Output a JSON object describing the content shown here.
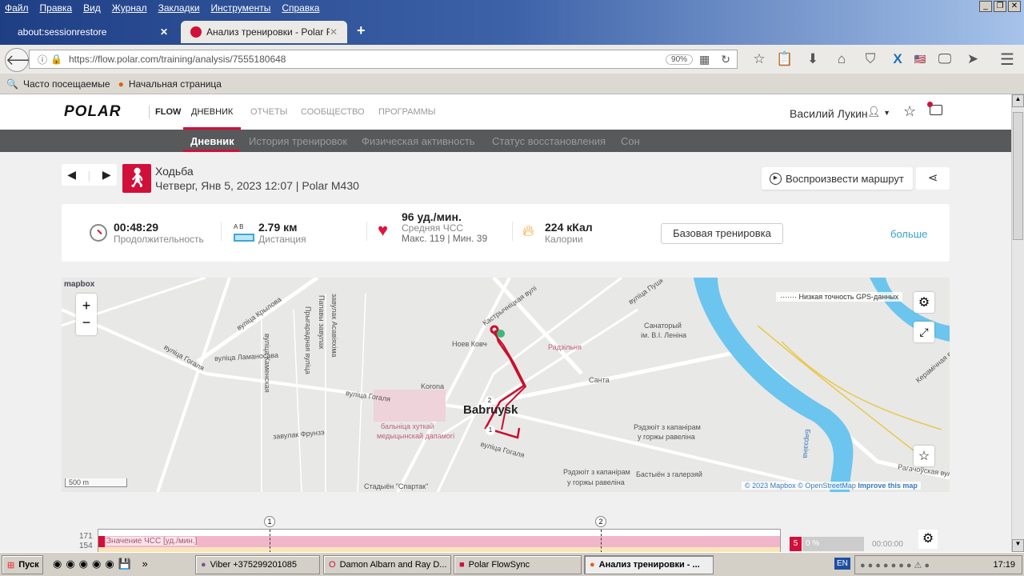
{
  "browser": {
    "menu": [
      "Файл",
      "Правка",
      "Вид",
      "Журнал",
      "Закладки",
      "Инструменты",
      "Справка"
    ],
    "tabs": [
      {
        "label": "about:sessionrestore"
      },
      {
        "label": "Анализ тренировки - Polar F..."
      }
    ],
    "url": "https://flow.polar.com/training/analysis/7555180648",
    "zoom": "90%",
    "bookmarks": [
      "Часто посещаемые",
      "Начальная страница"
    ]
  },
  "header": {
    "logo": "POLAR",
    "flow": "FLOW",
    "nav": [
      "ДНЕВНИК",
      "ОТЧЕТЫ",
      "СООБЩЕСТВО",
      "ПРОГРАММЫ"
    ],
    "user": "Василий Лукин"
  },
  "subnav": [
    "Дневник",
    "История тренировок",
    "Физическая активность",
    "Статус восстановления",
    "Сон"
  ],
  "training": {
    "sport": "Ходьба",
    "details": "Четверг, Янв 5, 2023 12:07 | Polar M430",
    "replay_label": "Воспроизвести маршрут"
  },
  "stats": {
    "duration": {
      "value": "00:48:29",
      "label": "Продолжительность"
    },
    "distance": {
      "value": "2.79 км",
      "label": "Дистанция",
      "ab": "A   B"
    },
    "hr": {
      "value": "96 уд./мин.",
      "label": "Средняя ЧСС",
      "minmax": "Макс. 119  |  Мин. 39"
    },
    "calories": {
      "value": "224 кКал",
      "label": "Калории"
    },
    "benefit": "Базовая тренировка",
    "more": "больше"
  },
  "map": {
    "brand": "mapbox",
    "zoom_in": "+",
    "zoom_out": "−",
    "gps_legend": "Низкая точность GPS-данных",
    "scale": "500 m",
    "attribution": {
      "copy": "© 2023 Mapbox",
      "osm": "© OpenStreetMap",
      "improve": "Improve this map"
    },
    "city": "Babruysk",
    "labels": [
      "вуліца Крылова",
      "вуліца Гогаля",
      "вуліца Ламаносава",
      "вуліца Каменская",
      "Прыгарадная вуліца",
      "Папавы завулак",
      "завулак Асавіяхіма",
      "вуліца Гогаля",
      "завулак Фрунзэ",
      "бальніца хуткай",
      "медыцынскай дапамогі",
      "Стадыён \"Спартак\"",
      "Korona",
      "Ноев Ковчег",
      "Радзільня",
      "Санаторый",
      "ім. В.І. Леніна",
      "Санта",
      "Рэдзюіт з капанірам",
      "у горжы равеліна",
      "Рэдзюіт з капанірам",
      "у горжы равеліна",
      "Бастыён з галерэяй",
      "Бярэзіна",
      "Рагачоўская вуліца",
      "Керамічная вуліца",
      "вуліца Гогаля",
      "вуліца Пушкіна",
      "Кастрычніцкая вуліца"
    ],
    "laps": [
      "1",
      "2"
    ],
    "colors": {
      "route": "#c8102e",
      "water": "#6cc5ee",
      "start": "#3cb878"
    }
  },
  "hr_chart": {
    "ticks": [
      "171",
      "154"
    ],
    "series_label": "Значение ЧСС [уд./мин.]",
    "lap_markers": [
      "1",
      "2"
    ],
    "zone": "5",
    "zone_pct": "0 %",
    "zone_time": "00:00:00"
  },
  "taskbar": {
    "start": "Пуск",
    "tasks": [
      "Viber +375299201085",
      "Damon Albarn and Ray D...",
      "Polar FlowSync",
      "Анализ тренировки - ..."
    ],
    "lang": "EN",
    "clock": "17:19"
  },
  "colors": {
    "accent": "#d0103a",
    "subnav": "#58595b",
    "link": "#3aa0d0"
  }
}
